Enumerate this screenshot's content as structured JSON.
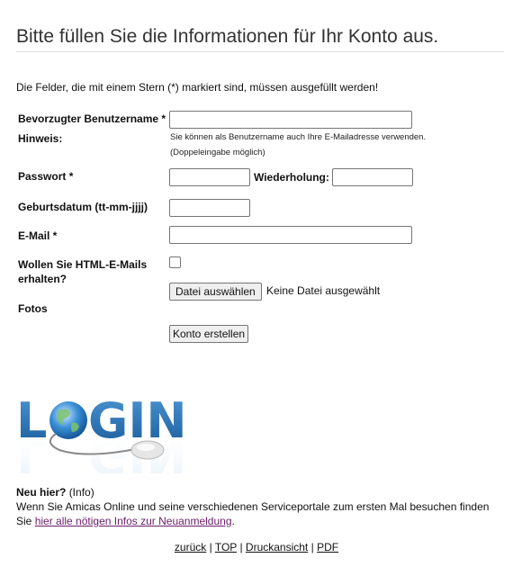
{
  "page": {
    "title": "Bitte füllen Sie die Informationen für Ihr Konto aus.",
    "intro": "Die Felder, die mit einem Stern (*) markiert sind, müssen ausgefüllt werden!"
  },
  "form": {
    "username_label": "Bevorzugter Benutzername *",
    "username_value": "",
    "hint_label": "Hinweis:",
    "hint_line1": "Sie können als Benutzername auch Ihre E-Mailadresse verwenden.",
    "hint_line2": "(Doppeleingabe möglich)",
    "password_label": "Passwort *",
    "repeat_label": "Wiederholung:",
    "birthdate_label": "Geburtsdatum (tt-mm-jjjj)",
    "email_label": "E-Mail *",
    "html_mail_label": "Wollen Sie HTML-E-Mails erhalten?",
    "html_mail_checked": false,
    "photos_label": "Fotos",
    "file_button": "Datei auswählen",
    "file_status": "Keine Datei ausgewählt",
    "submit_button": "Konto erstellen"
  },
  "logo": {
    "text": "LOGIN",
    "icon": "globe-mouse-logo",
    "colors": {
      "letters": "#2a73b8",
      "globe": "#3a8fd6",
      "mouse": "#d8d8d8"
    }
  },
  "new_here": {
    "heading": "Neu hier?",
    "info": "(Info)",
    "text": "Wenn Sie Amicas Online und seine verschiedenen Serviceportale zum ersten Mal besuchen finden Sie",
    "link": "hier alle nötigen Infos zur Neuanmeldung",
    "end": "."
  },
  "footer": {
    "links": [
      "zurück",
      "TOP",
      "Druckansicht",
      "PDF"
    ],
    "separator": "|"
  }
}
